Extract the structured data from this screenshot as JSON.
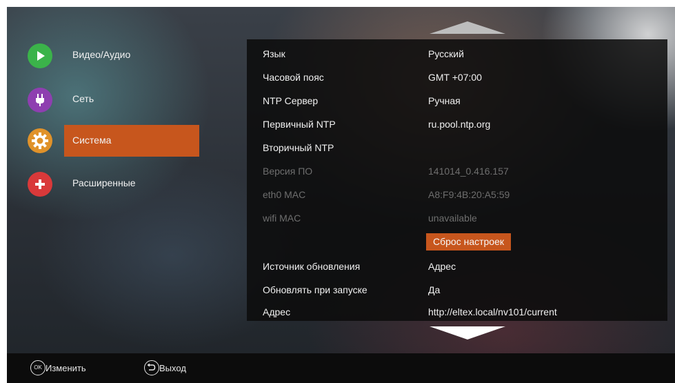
{
  "menu": {
    "items": [
      {
        "label": "Видео/Аудио",
        "icon": "play-icon",
        "color": "#3bb34a"
      },
      {
        "label": "Сеть",
        "icon": "plug-icon",
        "color": "#8e3fb0"
      },
      {
        "label": "Система",
        "icon": "gear-icon",
        "color": "#e0922a",
        "selected": true
      },
      {
        "label": "Расширенные",
        "icon": "plus-icon",
        "color": "#d9393a"
      }
    ]
  },
  "settings": {
    "rows": [
      {
        "key": "Язык",
        "value": "Русский"
      },
      {
        "key": "Часовой пояс",
        "value": "GMT +07:00"
      },
      {
        "key": "NTP Сервер",
        "value": "Ручная"
      },
      {
        "key": "Первичный NTP",
        "value": "ru.pool.ntp.org"
      },
      {
        "key": "Вторичный NTP",
        "value": ""
      },
      {
        "key": "Версия ПО",
        "value": "141014_0.416.157",
        "disabled": true
      },
      {
        "key": "eth0 MAC",
        "value": "A8:F9:4B:20:A5:59",
        "disabled": true
      },
      {
        "key": "wifi MAC",
        "value": "unavailable",
        "disabled": true
      },
      {
        "key": "",
        "button": "Сброс настроек"
      },
      {
        "key": "Источник обновления",
        "value": "Адрес"
      },
      {
        "key": "Обновлять при запуске",
        "value": "Да"
      },
      {
        "key": "Адрес",
        "value": "http://eltex.local/nv101/current"
      }
    ]
  },
  "footer": {
    "ok_symbol": "OK",
    "ok_label": "Изменить",
    "back_label": "Выход"
  },
  "colors": {
    "accent": "#c7561d",
    "disabled_text": "#6e6e6e"
  }
}
